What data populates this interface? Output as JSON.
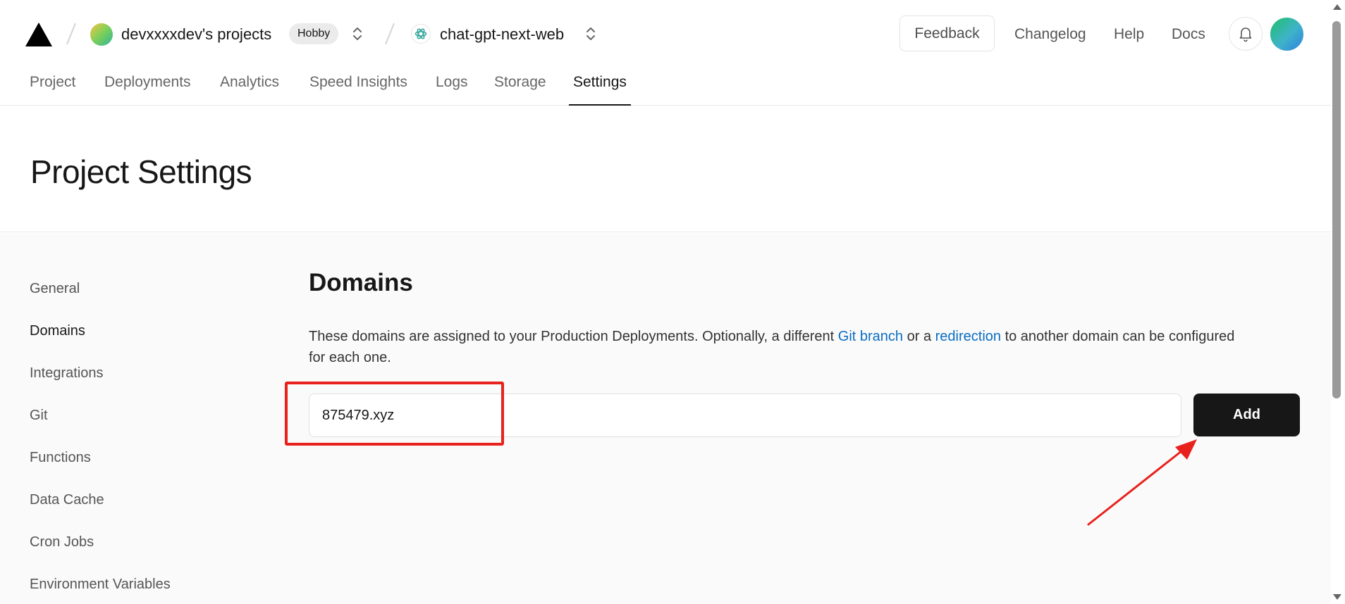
{
  "header": {
    "team_name": "devxxxxdev's projects",
    "plan_badge": "Hobby",
    "project_name": "chat-gpt-next-web",
    "feedback_label": "Feedback",
    "links": [
      "Changelog",
      "Help",
      "Docs"
    ]
  },
  "tabs": [
    {
      "label": "Project"
    },
    {
      "label": "Deployments"
    },
    {
      "label": "Analytics"
    },
    {
      "label": "Speed Insights"
    },
    {
      "label": "Logs"
    },
    {
      "label": "Storage"
    },
    {
      "label": "Settings",
      "active": true
    }
  ],
  "page": {
    "title": "Project Settings"
  },
  "sidebar": {
    "items": [
      {
        "label": "General"
      },
      {
        "label": "Domains",
        "active": true
      },
      {
        "label": "Integrations"
      },
      {
        "label": "Git"
      },
      {
        "label": "Functions"
      },
      {
        "label": "Data Cache"
      },
      {
        "label": "Cron Jobs"
      },
      {
        "label": "Environment Variables"
      }
    ]
  },
  "domains": {
    "title": "Domains",
    "desc_part1": "These domains are assigned to your Production Deployments. Optionally, a different ",
    "git_branch_link": "Git branch",
    "desc_part2": " or a ",
    "redirection_link": "redirection",
    "desc_part3": " to another domain can be configured for each one.",
    "input_value": "875479.xyz",
    "add_label": "Add"
  },
  "colors": {
    "accent_link": "#0a6dc2",
    "annotation_red": "#e8211d",
    "button_dark": "#171717"
  }
}
